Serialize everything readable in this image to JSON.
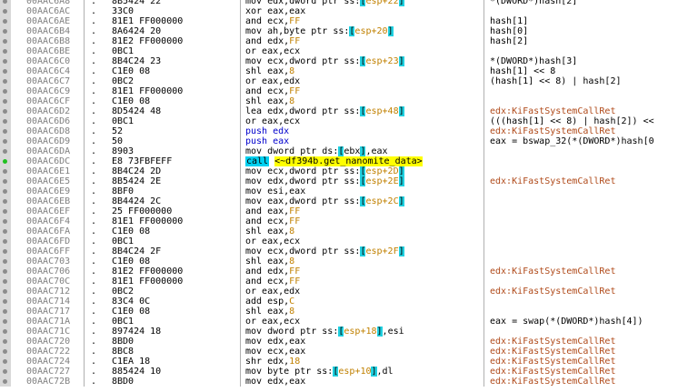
{
  "rows": [
    {
      "addr": "00AAC6A8",
      "bytes": "8B5424 22",
      "dis": [
        {
          "t": "mov edx,dword ptr ss:"
        },
        {
          "t": "[",
          "c": "br"
        },
        {
          "t": "esp+22",
          "c": "num"
        },
        {
          "t": "]",
          "c": "br"
        }
      ],
      "cmt": "*(DWORD*)hash[2]",
      "cc": "cmt"
    },
    {
      "addr": "00AAC6AC",
      "bytes": "33C0",
      "dis": [
        {
          "t": "xor eax,eax"
        }
      ],
      "cmt": "",
      "cc": "cmt"
    },
    {
      "addr": "00AAC6AE",
      "bytes": "81E1 FF000000",
      "dis": [
        {
          "t": "and ecx,"
        },
        {
          "t": "FF",
          "c": "num"
        }
      ],
      "cmt": "hash[1]",
      "cc": "cmt"
    },
    {
      "addr": "00AAC6B4",
      "bytes": "8A6424 20",
      "dis": [
        {
          "t": "mov ah,byte ptr ss:"
        },
        {
          "t": "[",
          "c": "br"
        },
        {
          "t": "esp+20",
          "c": "num"
        },
        {
          "t": "]",
          "c": "br"
        }
      ],
      "cmt": "hash[0]",
      "cc": "cmt"
    },
    {
      "addr": "00AAC6B8",
      "bytes": "81E2 FF000000",
      "dis": [
        {
          "t": "and edx,"
        },
        {
          "t": "FF",
          "c": "num"
        }
      ],
      "cmt": "hash[2]",
      "cc": "cmt"
    },
    {
      "addr": "00AAC6BE",
      "bytes": "0BC1",
      "dis": [
        {
          "t": "or eax,ecx"
        }
      ],
      "cmt": "",
      "cc": "cmt"
    },
    {
      "addr": "00AAC6C0",
      "bytes": "8B4C24 23",
      "dis": [
        {
          "t": "mov ecx,dword ptr ss:"
        },
        {
          "t": "[",
          "c": "br"
        },
        {
          "t": "esp+23",
          "c": "num"
        },
        {
          "t": "]",
          "c": "br"
        }
      ],
      "cmt": "*(DWORD*)hash[3]",
      "cc": "cmt"
    },
    {
      "addr": "00AAC6C4",
      "bytes": "C1E0 08",
      "dis": [
        {
          "t": "shl eax,"
        },
        {
          "t": "8",
          "c": "num"
        }
      ],
      "cmt": "hash[1] << 8",
      "cc": "cmt"
    },
    {
      "addr": "00AAC6C7",
      "bytes": "0BC2",
      "dis": [
        {
          "t": "or eax,edx"
        }
      ],
      "cmt": "(hash[1] << 8) | hash[2]",
      "cc": "cmt"
    },
    {
      "addr": "00AAC6C9",
      "bytes": "81E1 FF000000",
      "dis": [
        {
          "t": "and ecx,"
        },
        {
          "t": "FF",
          "c": "num"
        }
      ],
      "cmt": "",
      "cc": "cmt"
    },
    {
      "addr": "00AAC6CF",
      "bytes": "C1E0 08",
      "dis": [
        {
          "t": "shl eax,"
        },
        {
          "t": "8",
          "c": "num"
        }
      ],
      "cmt": "",
      "cc": "cmt"
    },
    {
      "addr": "00AAC6D2",
      "bytes": "8D5424 48",
      "dis": [
        {
          "t": "lea edx,dword ptr ss:"
        },
        {
          "t": "[",
          "c": "br"
        },
        {
          "t": "esp+48",
          "c": "num"
        },
        {
          "t": "]",
          "c": "br"
        }
      ],
      "cmt": "edx:KiFastSystemCallRet",
      "cc": "api"
    },
    {
      "addr": "00AAC6D6",
      "bytes": "0BC1",
      "dis": [
        {
          "t": "or eax,ecx"
        }
      ],
      "cmt": "(((hash[1] << 8) | hash[2]) <<",
      "cc": "cmt"
    },
    {
      "addr": "00AAC6D8",
      "bytes": "52",
      "dis": [
        {
          "t": "push edx",
          "c": "push"
        }
      ],
      "cmt": "edx:KiFastSystemCallRet",
      "cc": "api"
    },
    {
      "addr": "00AAC6D9",
      "bytes": "50",
      "dis": [
        {
          "t": "push eax",
          "c": "push"
        }
      ],
      "cmt": "eax = bswap_32(*(DWORD*)hash[0",
      "cc": "cmt"
    },
    {
      "addr": "00AAC6DA",
      "bytes": "8903",
      "dis": [
        {
          "t": "mov dword ptr ds:"
        },
        {
          "t": "[",
          "c": "br"
        },
        {
          "t": "ebx"
        },
        {
          "t": "]",
          "c": "br"
        },
        {
          "t": ",eax"
        }
      ],
      "cmt": "",
      "cc": "cmt"
    },
    {
      "addr": "00AAC6DC",
      "bytes": "E8 73FBFEFF",
      "dis": [
        {
          "t": "call",
          "c": "call"
        },
        {
          "t": " "
        },
        {
          "t": "<~df394b.get_nanomite_data>",
          "c": "tgt"
        }
      ],
      "cmt": "",
      "cc": "cmt",
      "active": true
    },
    {
      "addr": "00AAC6E1",
      "bytes": "8B4C24 2D",
      "dis": [
        {
          "t": "mov ecx,dword ptr ss:"
        },
        {
          "t": "[",
          "c": "br"
        },
        {
          "t": "esp+2D",
          "c": "num"
        },
        {
          "t": "]",
          "c": "br"
        }
      ],
      "cmt": "",
      "cc": "cmt"
    },
    {
      "addr": "00AAC6E5",
      "bytes": "8B5424 2E",
      "dis": [
        {
          "t": "mov edx,dword ptr ss:"
        },
        {
          "t": "[",
          "c": "br"
        },
        {
          "t": "esp+2E",
          "c": "num"
        },
        {
          "t": "]",
          "c": "br"
        }
      ],
      "cmt": "edx:KiFastSystemCallRet",
      "cc": "api"
    },
    {
      "addr": "00AAC6E9",
      "bytes": "8BF0",
      "dis": [
        {
          "t": "mov esi,eax"
        }
      ],
      "cmt": "",
      "cc": "cmt"
    },
    {
      "addr": "00AAC6EB",
      "bytes": "8B4424 2C",
      "dis": [
        {
          "t": "mov eax,dword ptr ss:"
        },
        {
          "t": "[",
          "c": "br"
        },
        {
          "t": "esp+2C",
          "c": "num"
        },
        {
          "t": "]",
          "c": "br"
        }
      ],
      "cmt": "",
      "cc": "cmt"
    },
    {
      "addr": "00AAC6EF",
      "bytes": "25 FF000000",
      "dis": [
        {
          "t": "and eax,"
        },
        {
          "t": "FF",
          "c": "num"
        }
      ],
      "cmt": "",
      "cc": "cmt"
    },
    {
      "addr": "00AAC6F4",
      "bytes": "81E1 FF000000",
      "dis": [
        {
          "t": "and ecx,"
        },
        {
          "t": "FF",
          "c": "num"
        }
      ],
      "cmt": "",
      "cc": "cmt"
    },
    {
      "addr": "00AAC6FA",
      "bytes": "C1E0 08",
      "dis": [
        {
          "t": "shl eax,"
        },
        {
          "t": "8",
          "c": "num"
        }
      ],
      "cmt": "",
      "cc": "cmt"
    },
    {
      "addr": "00AAC6FD",
      "bytes": "0BC1",
      "dis": [
        {
          "t": "or eax,ecx"
        }
      ],
      "cmt": "",
      "cc": "cmt"
    },
    {
      "addr": "00AAC6FF",
      "bytes": "8B4C24 2F",
      "dis": [
        {
          "t": "mov ecx,dword ptr ss:"
        },
        {
          "t": "[",
          "c": "br"
        },
        {
          "t": "esp+2F",
          "c": "num"
        },
        {
          "t": "]",
          "c": "br"
        }
      ],
      "cmt": "",
      "cc": "cmt"
    },
    {
      "addr": "00AAC703",
      "bytes": "C1E0 08",
      "dis": [
        {
          "t": "shl eax,"
        },
        {
          "t": "8",
          "c": "num"
        }
      ],
      "cmt": "",
      "cc": "cmt"
    },
    {
      "addr": "00AAC706",
      "bytes": "81E2 FF000000",
      "dis": [
        {
          "t": "and edx,"
        },
        {
          "t": "FF",
          "c": "num"
        }
      ],
      "cmt": "edx:KiFastSystemCallRet",
      "cc": "api"
    },
    {
      "addr": "00AAC70C",
      "bytes": "81E1 FF000000",
      "dis": [
        {
          "t": "and ecx,"
        },
        {
          "t": "FF",
          "c": "num"
        }
      ],
      "cmt": "",
      "cc": "cmt"
    },
    {
      "addr": "00AAC712",
      "bytes": "0BC2",
      "dis": [
        {
          "t": "or eax,edx"
        }
      ],
      "cmt": "edx:KiFastSystemCallRet",
      "cc": "api"
    },
    {
      "addr": "00AAC714",
      "bytes": "83C4 0C",
      "dis": [
        {
          "t": "add esp,"
        },
        {
          "t": "C",
          "c": "num"
        }
      ],
      "cmt": "",
      "cc": "cmt"
    },
    {
      "addr": "00AAC717",
      "bytes": "C1E0 08",
      "dis": [
        {
          "t": "shl eax,"
        },
        {
          "t": "8",
          "c": "num"
        }
      ],
      "cmt": "",
      "cc": "cmt"
    },
    {
      "addr": "00AAC71A",
      "bytes": "0BC1",
      "dis": [
        {
          "t": "or eax,ecx"
        }
      ],
      "cmt": "eax = swap(*(DWORD*)hash[4])",
      "cc": "cmt"
    },
    {
      "addr": "00AAC71C",
      "bytes": "897424 18",
      "dis": [
        {
          "t": "mov dword ptr ss:"
        },
        {
          "t": "[",
          "c": "br"
        },
        {
          "t": "esp+18",
          "c": "num"
        },
        {
          "t": "]",
          "c": "br"
        },
        {
          "t": ",esi"
        }
      ],
      "cmt": "",
      "cc": "cmt"
    },
    {
      "addr": "00AAC720",
      "bytes": "8BD0",
      "dis": [
        {
          "t": "mov edx,eax"
        }
      ],
      "cmt": "edx:KiFastSystemCallRet",
      "cc": "api"
    },
    {
      "addr": "00AAC722",
      "bytes": "8BC8",
      "dis": [
        {
          "t": "mov ecx,eax"
        }
      ],
      "cmt": "edx:KiFastSystemCallRet",
      "cc": "api"
    },
    {
      "addr": "00AAC724",
      "bytes": "C1EA 18",
      "dis": [
        {
          "t": "shr edx,"
        },
        {
          "t": "18",
          "c": "num"
        }
      ],
      "cmt": "edx:KiFastSystemCallRet",
      "cc": "api"
    },
    {
      "addr": "00AAC727",
      "bytes": "885424 10",
      "dis": [
        {
          "t": "mov byte ptr ss:"
        },
        {
          "t": "[",
          "c": "br"
        },
        {
          "t": "esp+10",
          "c": "num"
        },
        {
          "t": "]",
          "c": "br"
        },
        {
          "t": ",dl"
        }
      ],
      "cmt": "edx:KiFastSystemCallRet",
      "cc": "api"
    },
    {
      "addr": "00AAC72B",
      "bytes": "8BD0",
      "dis": [
        {
          "t": "mov edx,eax"
        }
      ],
      "cmt": "edx:KiFastSystemCallRet",
      "cc": "api"
    }
  ],
  "row_marker": "."
}
